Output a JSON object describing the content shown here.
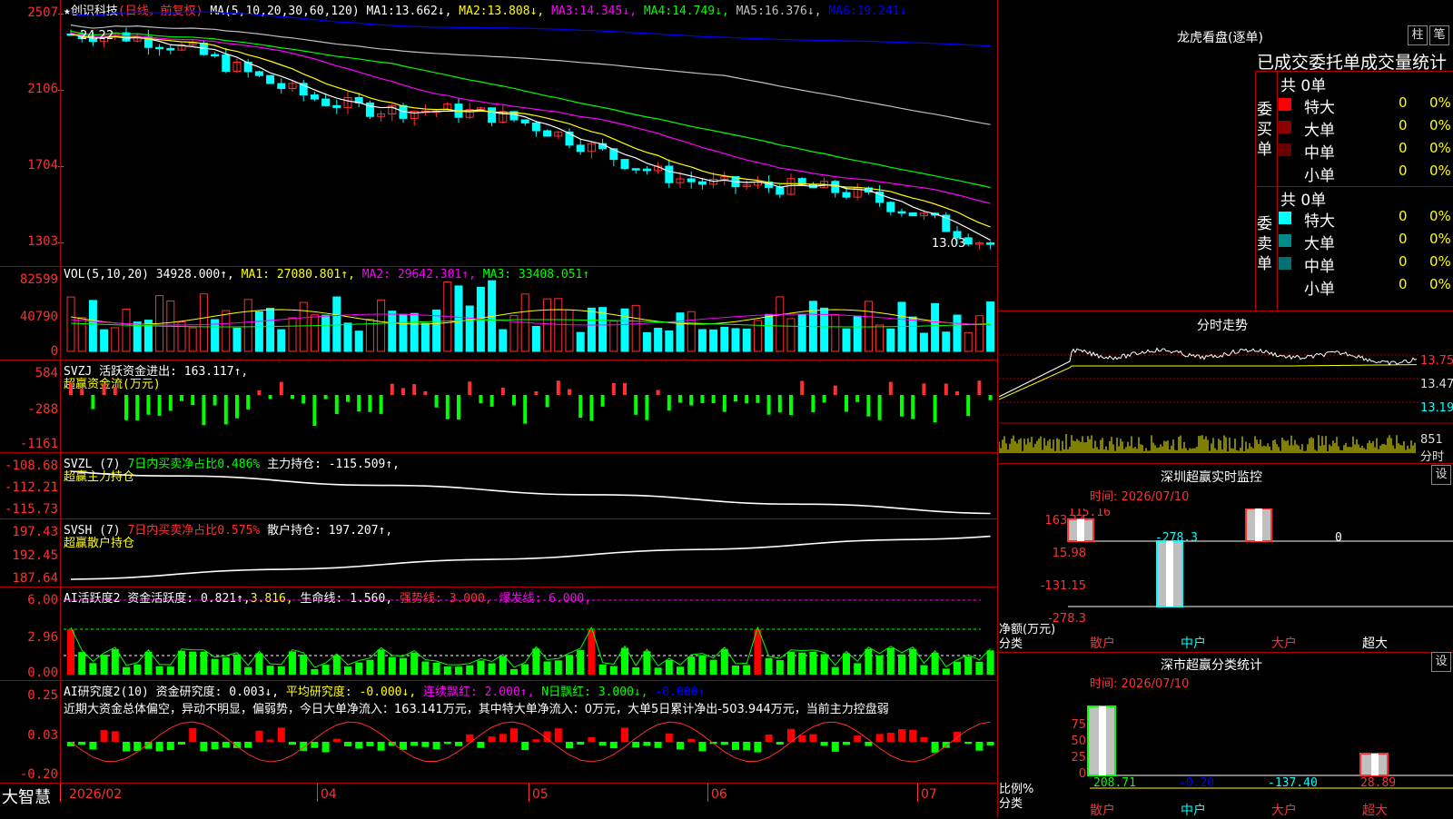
{
  "header": {
    "star": "★",
    "stock_name": "创识科技",
    "period": "(日线，前复权)",
    "ma_label": "MA(5,10,20,30,60,120)",
    "ma": [
      {
        "label": "MA1:",
        "value": "13.662↓,",
        "color": "#ffffff"
      },
      {
        "label": "MA2:",
        "value": "13.808↓,",
        "color": "#ffff00"
      },
      {
        "label": "MA3:",
        "value": "14.345↓,",
        "color": "#ff00ff"
      },
      {
        "label": "MA4:",
        "value": "14.749↓,",
        "color": "#00ff00"
      },
      {
        "label": "MA5:",
        "value": "16.376↓,",
        "color": "#c0c0c0"
      },
      {
        "label": "MA6:",
        "value": "19.241↓",
        "color": "#0000ff"
      }
    ]
  },
  "price_panel": {
    "y_labels": [
      "2507",
      "2106",
      "1704",
      "1303"
    ],
    "high_label": "24.22",
    "low_label": "13.03"
  },
  "vol_panel": {
    "title": "VOL(5,10,20)",
    "value": "34928.000↑,",
    "ma1": "MA1: 27080.801↑,",
    "ma2": "MA2: 29642.301↑,",
    "ma3": "MA3: 33408.051↑",
    "y_labels": [
      "82599",
      "40790",
      "0"
    ]
  },
  "svzj_panel": {
    "title": "SVZJ  活跃资金进出: 163.117↑,",
    "subtitle": "超赢资金流(万元)",
    "y_labels": [
      "584",
      "-288",
      "-1161"
    ]
  },
  "svzl_panel": {
    "title": "SVZL (7)",
    "part1": "7日内买卖净占比0.486%",
    "part2": "主力持仓: -115.509↑,",
    "subtitle": "超赢主力持仓",
    "y_labels": [
      "-108.68",
      "-112.21",
      "-115.73"
    ]
  },
  "svsh_panel": {
    "title": "SVSH (7)",
    "part1": "7日内买卖净占比0.575%",
    "part2": "散户持仓: 197.207↑,",
    "subtitle": "超赢散户持仓",
    "y_labels": [
      "197.43",
      "192.45",
      "187.64"
    ]
  },
  "ai_active_panel": {
    "title": "AI活跃度2 资金活跃度: 0.821↑,",
    "v2": "3.816,",
    "v3": "生命线: 1.560,",
    "v4": "强势线: 3.000,",
    "v5": "爆发线: 6.000,",
    "y_labels": [
      "6.00",
      "2.96",
      "0.00"
    ]
  },
  "ai_research_panel": {
    "title": "AI研究度2(10) 资金研究度: 0.003↓,",
    "v2": "平均研究度: -0.000↓,",
    "v3": "连续飘红: 2.000↑,",
    "v4": "N日飘红: 3.000↓,",
    "v5": "-0.000↑",
    "comment": "近期大资金总体偏空，异动不明显，偏弱势，今日大单净流入：163.141万元，其中特大单净流入：0万元，大单5日累计净出-503.944万元，当前主力控盘弱",
    "y_labels": [
      "0.25",
      "0.03",
      "-0.20"
    ]
  },
  "bottom_axis": {
    "brand": "大智慧",
    "dates": [
      "2026/02",
      "04",
      "05",
      "06",
      "07"
    ]
  },
  "right_panel": {
    "dragon_title": "龙虎看盘(逐单)",
    "btn_bar": "柱",
    "btn_pen": "笔",
    "stats_title": "已成交委托单成交量统计",
    "buy_label": "委买单",
    "sell_label": "委卖单",
    "buy_total": "共 0单",
    "sell_total": "共 0单",
    "buy_rows": [
      {
        "name": "特大",
        "count": "0",
        "pct": "0%",
        "color": "#ff0000"
      },
      {
        "name": "大单",
        "count": "0",
        "pct": "0%",
        "color": "#8b0000"
      },
      {
        "name": "中单",
        "count": "0",
        "pct": "0%",
        "color": "#6b0000"
      },
      {
        "name": "小单",
        "count": "0",
        "pct": "0%",
        "color": ""
      }
    ],
    "sell_rows": [
      {
        "name": "特大",
        "count": "0",
        "pct": "0%",
        "color": "#00ffff"
      },
      {
        "name": "大单",
        "count": "0",
        "pct": "0%",
        "color": "#008b8b"
      },
      {
        "name": "中单",
        "count": "0",
        "pct": "0%",
        "color": "#007070"
      },
      {
        "name": "小单",
        "count": "0",
        "pct": "0%",
        "color": ""
      }
    ],
    "minute_title": "分时走势",
    "minute_y_labels": [
      "13.75",
      "13.47",
      "13.19",
      "851"
    ],
    "minute_minute_label": "分时",
    "monitor_title": "深圳超赢实时监控",
    "monitor_time": "时间: 2026/07/10",
    "monitor_btn": "设",
    "monitor_y_labels": [
      "163.14",
      "15.98",
      "-131.15",
      "-278.3"
    ],
    "monitor_values": [
      "115.16",
      "-278.3",
      "163.14",
      "0"
    ],
    "monitor_unit": "净额(万元)",
    "monitor_cat_label": "分类",
    "categories": [
      "散户",
      "中户",
      "大户",
      "超大"
    ],
    "class_title": "深市超赢分类统计",
    "class_time": "时间: 2026/07/10",
    "class_btn": "设",
    "class_y_labels": [
      "75",
      "50",
      "25",
      "0"
    ],
    "class_values": [
      "208.71",
      "-0.20",
      "-137.40",
      "28.89"
    ],
    "class_unit": "比例%",
    "class_cat_label": "分类"
  },
  "colors": {
    "up": "#ff3030",
    "down": "#00ffff",
    "grid": "#b00000"
  }
}
